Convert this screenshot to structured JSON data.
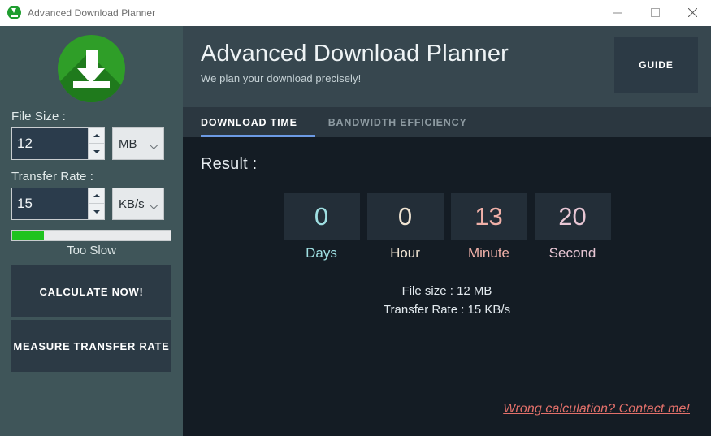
{
  "window": {
    "title": "Advanced Download Planner",
    "icon": "download-circle-icon",
    "minimize_label": "–",
    "maximize_label": "□",
    "close_label": "✕"
  },
  "sidebar": {
    "logo_icon": "download-circle-icon",
    "file_size": {
      "label": "File Size :",
      "value": "12",
      "unit": "MB",
      "unit_icon": "chevron-down-icon"
    },
    "transfer_rate": {
      "label": "Transfer Rate :",
      "value": "15",
      "unit": "KB/s",
      "unit_icon": "chevron-down-icon"
    },
    "speed_meter": {
      "percent": 20,
      "caption": "Too Slow",
      "fill_color": "#1fc31f"
    },
    "calculate_button": "CALCULATE NOW!",
    "measure_button": "MEASURE TRANSFER RATE"
  },
  "header": {
    "title": "Advanced Download Planner",
    "subtitle": "We plan your download precisely!",
    "guide_button": "GUIDE"
  },
  "tabs": [
    {
      "label": "DOWNLOAD TIME",
      "active": true
    },
    {
      "label": "BANDWIDTH EFFICIENCY",
      "active": false
    }
  ],
  "result": {
    "label": "Result :",
    "counters": [
      {
        "value": "0",
        "name": "Days",
        "color": "#9fdfe2"
      },
      {
        "value": "0",
        "name": "Hour",
        "color": "#f0e4d2"
      },
      {
        "value": "13",
        "name": "Minute",
        "color": "#f0b0a8"
      },
      {
        "value": "20",
        "name": "Second",
        "color": "#e8c6d4"
      }
    ],
    "summary": [
      "File size : 12 MB",
      "Transfer Rate : 15 KB/s"
    ],
    "contact_link": "Wrong calculation? Contact me!"
  },
  "theme": {
    "sidebar_bg": "#3f5559",
    "header_bg": "#37474f",
    "panel_bg": "#141c24",
    "tab_bg": "#2b3740",
    "accent": "#6c9ae4",
    "button_bg": "#2c3a45",
    "link_color": "#e2706a"
  }
}
